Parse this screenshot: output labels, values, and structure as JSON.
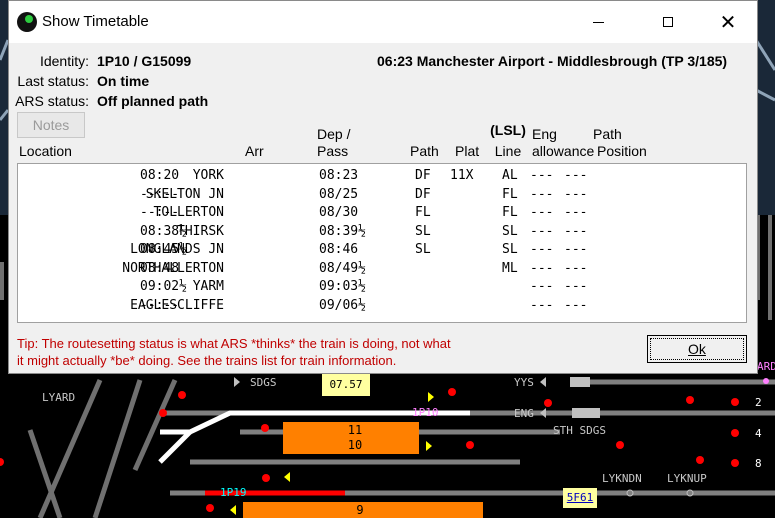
{
  "dialog": {
    "title": "Show Timetable",
    "identity_label": "Identity:",
    "identity_value": "1P10 / G15099",
    "service": "06:23 Manchester Airport - Middlesbrough (TP 3/185)",
    "last_status_label": "Last status:",
    "last_status_value": "On time",
    "ars_status_label": "ARS status:",
    "ars_status_value": "Off planned path",
    "notes_button": "Notes",
    "columns": {
      "location": "Location",
      "arr": "Arr",
      "dep1": "Dep /",
      "dep2": "Pass",
      "path": "Path",
      "plat": "Plat",
      "line1": "(LSL)",
      "line2": "Line",
      "eng1": "Eng",
      "eng2": "allowance",
      "pathpos1": "Path",
      "pathpos2": "Position"
    },
    "rows": [
      {
        "location": "YORK",
        "arr": "08:20",
        "dep": "08:23",
        "path": "DF",
        "plat": "11X",
        "line": "AL",
        "eng": "---",
        "pos": "---"
      },
      {
        "location": "SKELTON JN",
        "arr": "--:--",
        "dep": "08/25",
        "path": "DF",
        "plat": "",
        "line": "FL",
        "eng": "---",
        "pos": "---"
      },
      {
        "location": "TOLLERTON",
        "arr": "--:--",
        "dep": "08/30",
        "path": "FL",
        "plat": "",
        "line": "FL",
        "eng": "---",
        "pos": "---"
      },
      {
        "location": "THIRSK",
        "arr": "08:38½",
        "dep": "08:39½",
        "path": "SL",
        "plat": "",
        "line": "SL",
        "eng": "---",
        "pos": "---"
      },
      {
        "location": "LONGLANDS JN",
        "arr": "08:45½",
        "dep": "08:46",
        "path": "SL",
        "plat": "",
        "line": "SL",
        "eng": "---",
        "pos": "---"
      },
      {
        "location": "NORTHALLERTON",
        "arr": "08:48",
        "dep": "08/49½",
        "path": "",
        "plat": "",
        "line": "ML",
        "eng": "---",
        "pos": "---"
      },
      {
        "location": "YARM",
        "arr": "09:02½",
        "dep": "09:03½",
        "path": "",
        "plat": "",
        "line": "",
        "eng": "---",
        "pos": "---"
      },
      {
        "location": "EAGLESCLIFFE",
        "arr": "--:--",
        "dep": "09/06½",
        "path": "",
        "plat": "",
        "line": "",
        "eng": "---",
        "pos": "---"
      }
    ],
    "tip_line1": "Tip: The routesetting status is what ARS *thinks* the train is doing, not what",
    "tip_line2": "it might actually *be* doing. See the trains list for train information.",
    "ok_button": "Ok"
  },
  "simulation": {
    "labels": {
      "lyard": "LYARD",
      "sdgs": "SDGS",
      "yys": "YYS",
      "eng": "ENG",
      "sth_sdgs": "STH SDGS",
      "lykndn": "LYKNDN",
      "lyknup": "LYKNUP",
      "ard": "ARD",
      "sig2": "2",
      "sig4": "4",
      "sig8": "8"
    },
    "clock": "07.57",
    "headcode_1p10": "1P10",
    "headcode_1p19": "1P19",
    "berth_5f61": "5F61",
    "platform_11": "11",
    "platform_10": "10",
    "platform_9": "9",
    "colors": {
      "track": "#808080",
      "route": "#ffffff",
      "occupied": "#ff0000",
      "platform": "#ff8000",
      "signal": "#ff0000",
      "headcode": "#ff80ff",
      "headcode_alt": "#00ffff",
      "berth": "#ffffa0"
    }
  }
}
